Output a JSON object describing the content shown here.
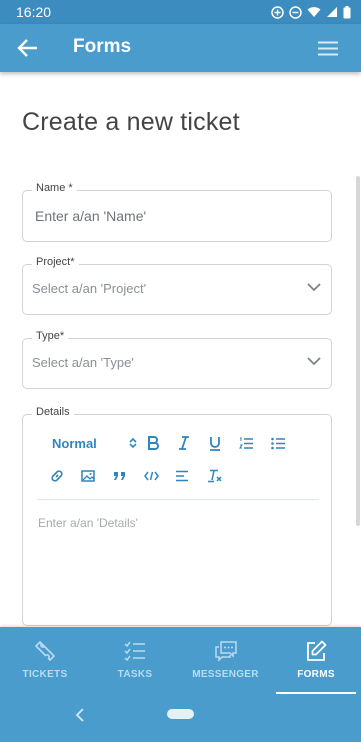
{
  "status_bar": {
    "time": "16:20"
  },
  "app_bar": {
    "title": "Forms"
  },
  "form": {
    "heading": "Create a new ticket",
    "name": {
      "label": "Name *",
      "placeholder": "Enter a/an 'Name'"
    },
    "project": {
      "label": "Project*",
      "value": "Select a/an 'Project'"
    },
    "type": {
      "label": "Type*",
      "value": "Select a/an 'Type'"
    },
    "details": {
      "label": "Details",
      "heading_select": "Normal",
      "placeholder": "Enter a/an 'Details'"
    }
  },
  "bottom_nav": [
    {
      "label": "TICKETS",
      "icon": "ticket-icon",
      "active": false
    },
    {
      "label": "TASKS",
      "icon": "tasks-icon",
      "active": false
    },
    {
      "label": "MESSENGER",
      "icon": "messenger-icon",
      "active": false
    },
    {
      "label": "FORMS",
      "icon": "forms-icon",
      "active": true
    }
  ],
  "colors": {
    "primary": "#4a9ccd",
    "status_bar": "#3d8cbf",
    "accent": "#2f86bd"
  }
}
